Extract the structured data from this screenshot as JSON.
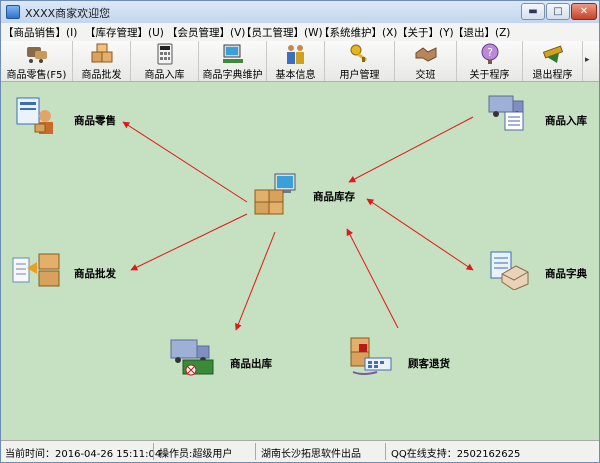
{
  "window": {
    "title": "XXXX商家欢迎您",
    "minimize_symbol": "▬",
    "maximize_symbol": "□",
    "close_symbol": "✕"
  },
  "menu": {
    "items": [
      {
        "label": "【商品销售】(I)"
      },
      {
        "label": "【库存管理】(U)"
      },
      {
        "label": "【会员管理】(V)"
      },
      {
        "label": "【员工管理】(W)"
      },
      {
        "label": "【系统维护】(X)"
      },
      {
        "label": "【关于】(Y)"
      },
      {
        "label": "【退出】(Z)"
      }
    ]
  },
  "toolbar": {
    "items": [
      {
        "label": "商品零售(F5)",
        "icon": "handshake-cart-icon"
      },
      {
        "label": "商品批发",
        "icon": "boxes-icon"
      },
      {
        "label": "商品入库",
        "icon": "calculator-icon"
      },
      {
        "label": "商品字典维护",
        "icon": "computer-icon"
      },
      {
        "label": "基本信息",
        "icon": "people-icon"
      },
      {
        "label": "用户管理",
        "icon": "keys-icon"
      },
      {
        "label": "交班",
        "icon": "handshake-icon"
      },
      {
        "label": "关于程序",
        "icon": "question-icon"
      },
      {
        "label": "退出程序",
        "icon": "exit-icon"
      }
    ],
    "more_symbol": "▸"
  },
  "diagram": {
    "nodes": {
      "retail": {
        "label": "商品零售",
        "icon": "cashier-icon"
      },
      "inbound": {
        "label": "商品入库",
        "icon": "delivery-truck-icon"
      },
      "stock": {
        "label": "商品库存",
        "icon": "inventory-icon"
      },
      "wholesale": {
        "label": "商品批发",
        "icon": "wholesale-boxes-icon"
      },
      "dictionary": {
        "label": "商品字典",
        "icon": "dictionary-icon"
      },
      "outbound": {
        "label": "商品出库",
        "icon": "outbound-truck-icon"
      },
      "returns": {
        "label": "顾客退货",
        "icon": "customer-return-icon"
      }
    },
    "arrow_color": "#e01818"
  },
  "status": {
    "time": "当前时间：2016-04-26 15:11:04",
    "operator": "操作员:超级用户",
    "company": "湖南长沙拓思软件出品",
    "support": "QQ在线支持：2502162625"
  }
}
